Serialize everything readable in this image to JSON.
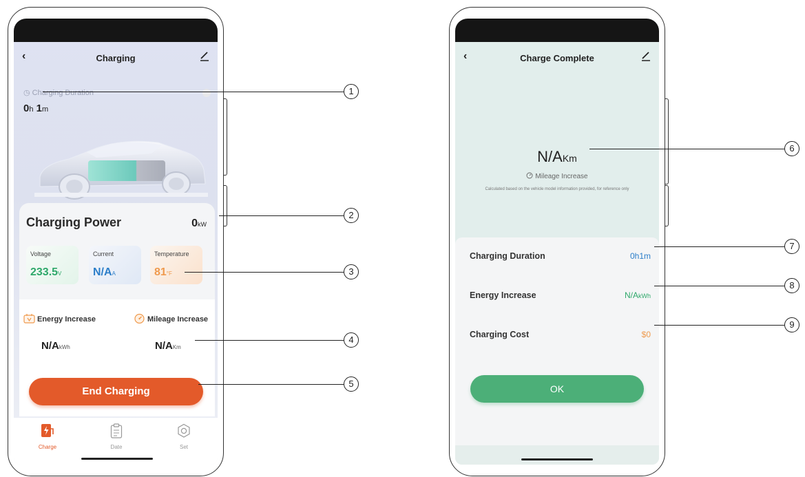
{
  "left_screen": {
    "title": "Charging",
    "duration": {
      "label": "Charging Duration",
      "hours": "0",
      "hours_unit": "h",
      "minutes": "1",
      "minutes_unit": "m"
    },
    "power": {
      "label": "Charging Power",
      "value": "0",
      "unit": "kW"
    },
    "metrics": [
      {
        "label": "Voltage",
        "value": "233.5",
        "unit": "V",
        "color": "#2ea86a"
      },
      {
        "label": "Current",
        "value": "N/A",
        "unit": "A",
        "color": "#2c7ec9"
      },
      {
        "label": "Temperature",
        "value": "81",
        "unit": "°F",
        "color": "#ef9a4d"
      }
    ],
    "energy": {
      "label": "Energy Increase",
      "value": "N/A",
      "unit": "kWh"
    },
    "mileage": {
      "label": "Mileage Increase",
      "value": "N/A",
      "unit": "Km"
    },
    "end_button": "End Charging",
    "tabs": [
      {
        "label": "Charge",
        "icon": "charge-icon",
        "active": true
      },
      {
        "label": "Date",
        "icon": "clipboard-icon",
        "active": false
      },
      {
        "label": "Set",
        "icon": "hexagon-settings-icon",
        "active": false
      }
    ],
    "accent": "#e35a2a"
  },
  "right_screen": {
    "title": "Charge Complete",
    "mileage": {
      "value": "N/A",
      "unit": "Km",
      "label": "Mileage Increase"
    },
    "note": "Calculated based on the vehicle model information provided, for reference only",
    "rows": [
      {
        "label": "Charging Duration",
        "value": "0h1m",
        "color": "#2c7ec9"
      },
      {
        "label": "Energy Increase",
        "value": "N/A",
        "unit": "kWh",
        "color": "#2ea86a"
      },
      {
        "label": "Charging Cost",
        "value": "$0",
        "color": "#ef9a4d"
      }
    ],
    "ok_button": "OK",
    "accent": "#4caf78"
  },
  "callouts": [
    "1",
    "2",
    "3",
    "4",
    "5",
    "6",
    "7",
    "8",
    "9"
  ]
}
